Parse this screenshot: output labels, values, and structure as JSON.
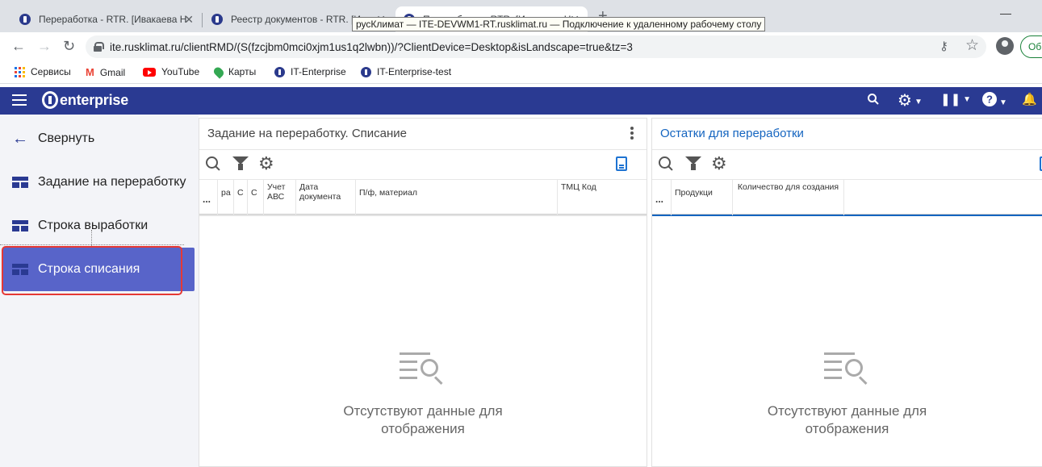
{
  "browser": {
    "tabs": [
      {
        "title": "Переработка - RTR. [Ивакаева Н",
        "active": false
      },
      {
        "title": "Реестр документов - RTR. [Ивак",
        "active": false
      },
      {
        "title": "Переработка - RTR. [Ивакаева Н",
        "active": true
      }
    ],
    "new_tab": "+",
    "tooltip": "русКлимат — ITE-DEVWM1-RT.rusklimat.ru — Подключение к удаленному рабочему столу",
    "url": "ite.rusklimat.ru/clientRMD/(S(fzcjbm0mci0xjm1us1q2lwbn))/?ClientDevice=Desktop&isLandscape=true&tz=3",
    "update_button": "Об",
    "bookmarks": [
      {
        "label": "Сервисы",
        "icon": "apps-grid-icon"
      },
      {
        "label": "Gmail",
        "icon": "gmail-icon"
      },
      {
        "label": "YouTube",
        "icon": "youtube-icon"
      },
      {
        "label": "Карты",
        "icon": "maps-icon"
      },
      {
        "label": "IT-Enterprise",
        "icon": "it-enterprise-icon"
      },
      {
        "label": "IT-Enterprise-test",
        "icon": "it-enterprise-icon"
      }
    ]
  },
  "app": {
    "logo_text": "enterprise",
    "accent_color": "#2a3a92",
    "sidebar": {
      "collapse_label": "Свернуть",
      "items": [
        {
          "label": "Задание на переработку",
          "active": false
        },
        {
          "label": "Строка выработки",
          "active": false
        },
        {
          "label": "Строка списания",
          "active": true
        }
      ]
    },
    "left_panel": {
      "title": "Задание на переработку. Списание",
      "columns": [
        "...",
        "ра",
        "С",
        "С",
        "Учет АВС",
        "Дата документа",
        "П/ф, материал",
        "ТМЦ Код"
      ],
      "empty_text": "Отсутствуют данные для отображения"
    },
    "right_panel": {
      "title": "Остатки для переработки",
      "columns": [
        "...",
        "Продукци",
        "Количество для создания"
      ],
      "empty_text": "Отсутствуют данные для отображения"
    }
  }
}
